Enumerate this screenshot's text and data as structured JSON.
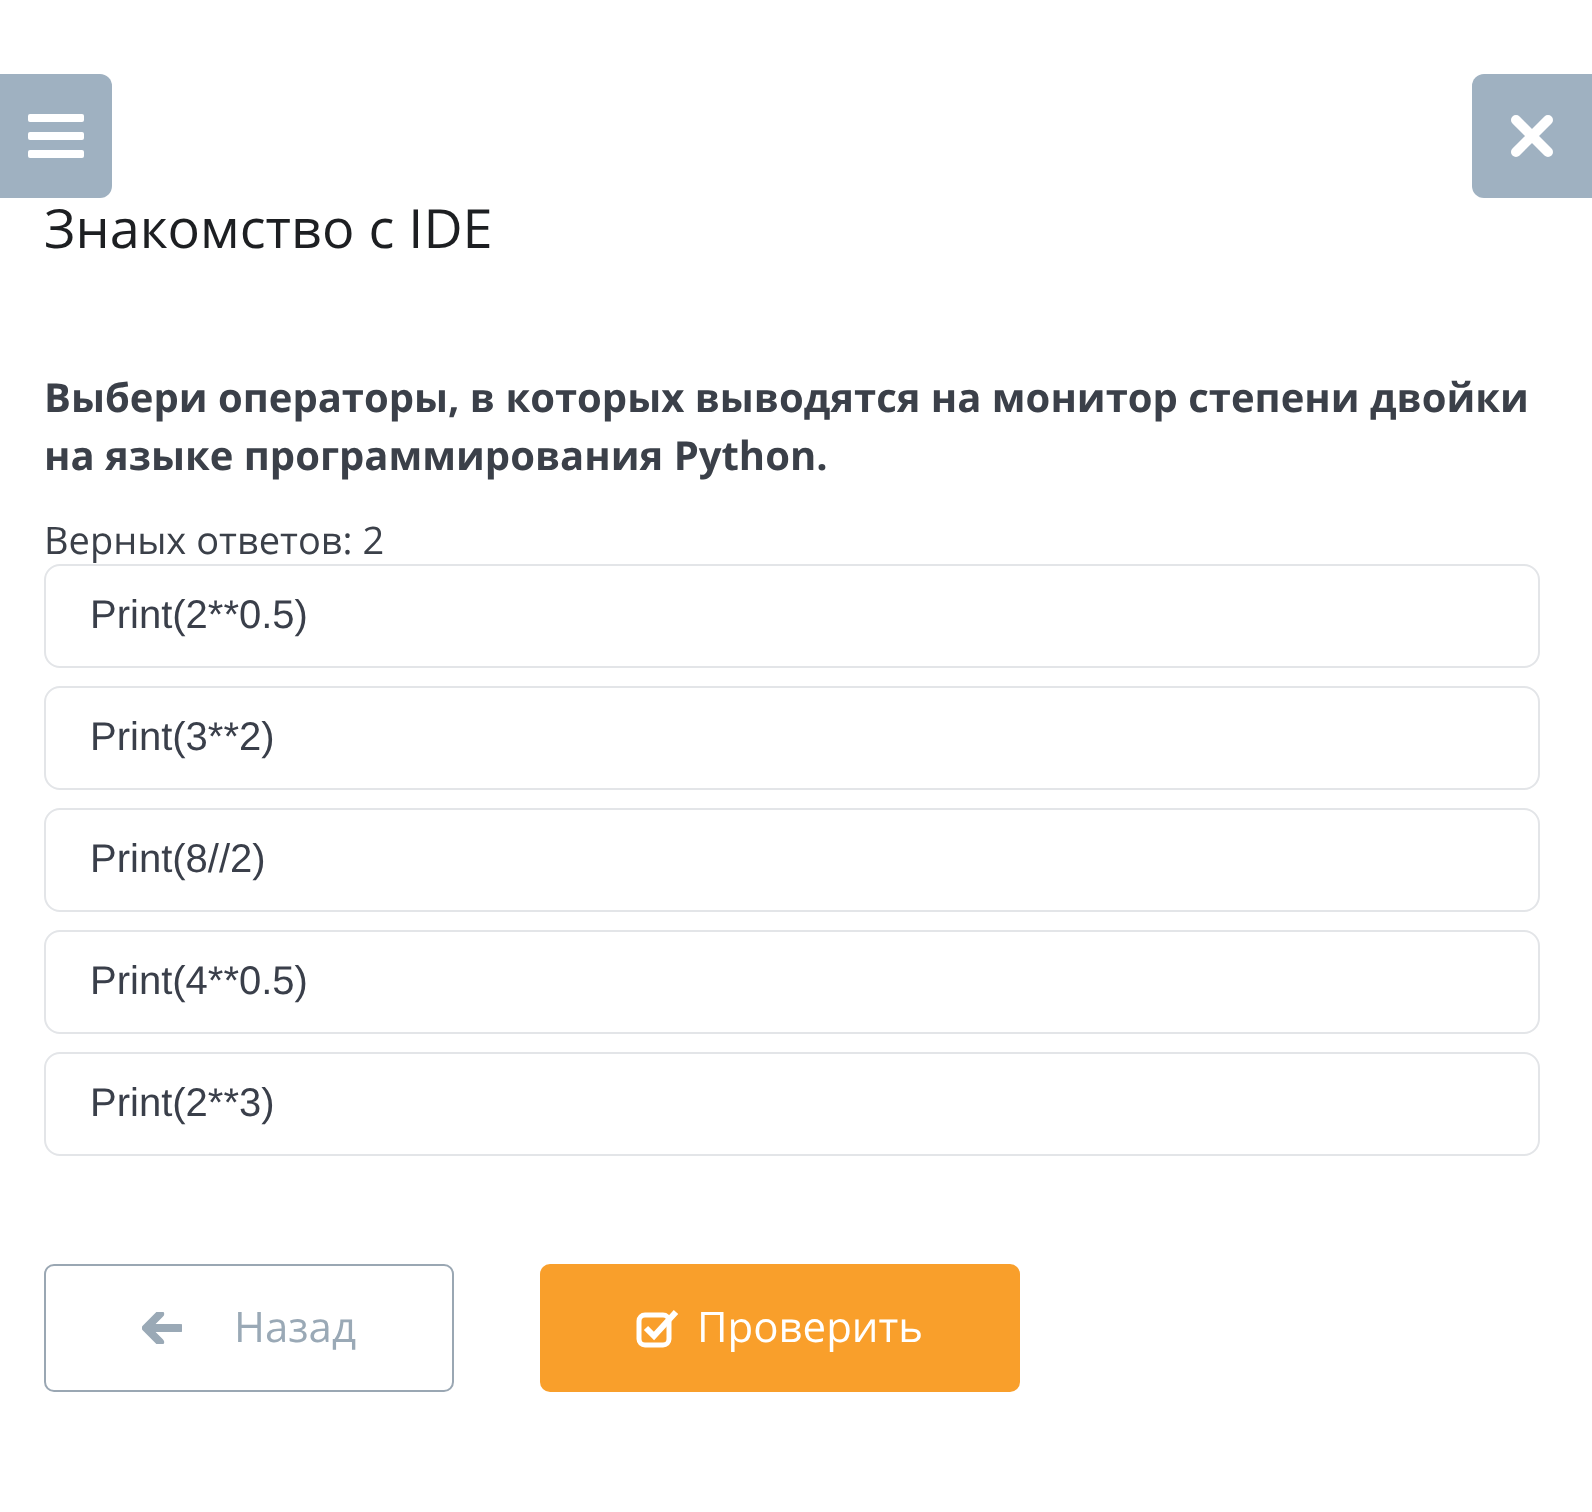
{
  "header": {
    "title": "Знакомство с IDE"
  },
  "question": {
    "text": "Выбери операторы, в которых выводятся на монитор степени двойки на языке программирования Python.",
    "answers_count": "Верных ответов: 2"
  },
  "options": [
    {
      "label": "Print(2**0.5)",
      "selected": false
    },
    {
      "label": "Print(3**2)",
      "selected": false
    },
    {
      "label": "Print(8//2)",
      "selected": false
    },
    {
      "label": "Print(4**0.5)",
      "selected": false
    },
    {
      "label": "Print(2**3)",
      "selected": false
    }
  ],
  "buttons": {
    "back": "Назад",
    "check": "Проверить"
  }
}
